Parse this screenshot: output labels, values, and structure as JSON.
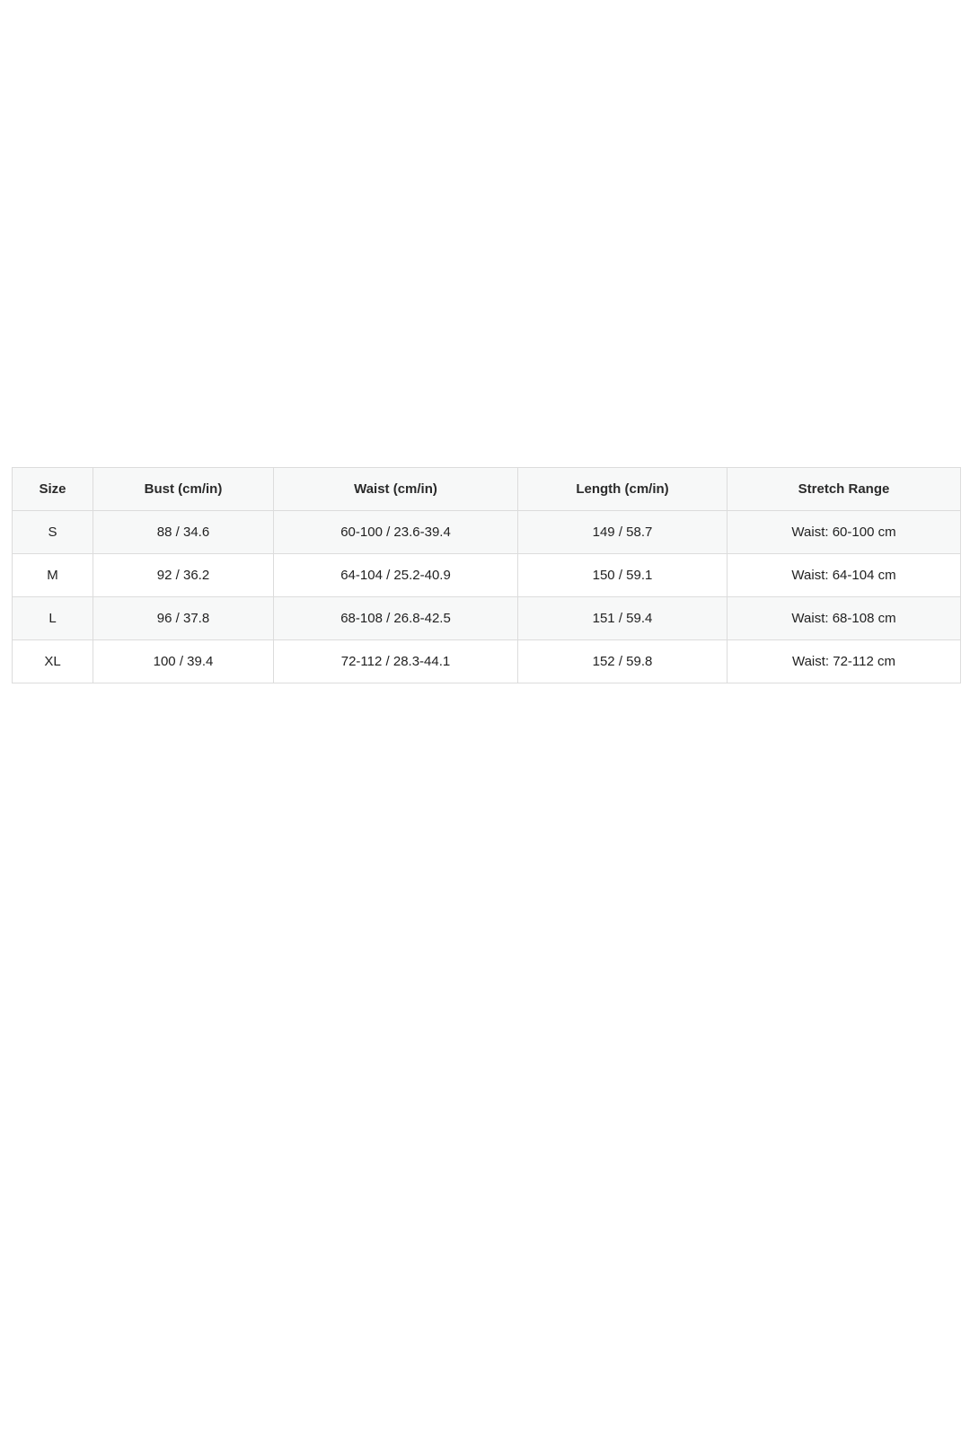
{
  "size_chart": {
    "headers": {
      "size": "Size",
      "bust": "Bust (cm/in)",
      "waist": "Waist (cm/in)",
      "length": "Length (cm/in)",
      "stretch": "Stretch Range"
    },
    "rows": [
      {
        "size": "S",
        "bust": "88 / 34.6",
        "waist": "60-100 / 23.6-39.4",
        "length": "149 / 58.7",
        "stretch": "Waist: 60-100 cm"
      },
      {
        "size": "M",
        "bust": "92 / 36.2",
        "waist": "64-104 / 25.2-40.9",
        "length": "150 / 59.1",
        "stretch": "Waist: 64-104 cm"
      },
      {
        "size": "L",
        "bust": "96 / 37.8",
        "waist": "68-108 / 26.8-42.5",
        "length": "151 / 59.4",
        "stretch": "Waist: 68-108 cm"
      },
      {
        "size": "XL",
        "bust": "100 / 39.4",
        "waist": "72-112 / 28.3-44.1",
        "length": "152 / 59.8",
        "stretch": "Waist: 72-112 cm"
      }
    ],
    "colors": {
      "header_bg": "#f7f8f8",
      "stripe_bg": "#f7f8f8",
      "row_bg": "#ffffff",
      "border": "#dcdcdc",
      "text": "#222222"
    }
  }
}
